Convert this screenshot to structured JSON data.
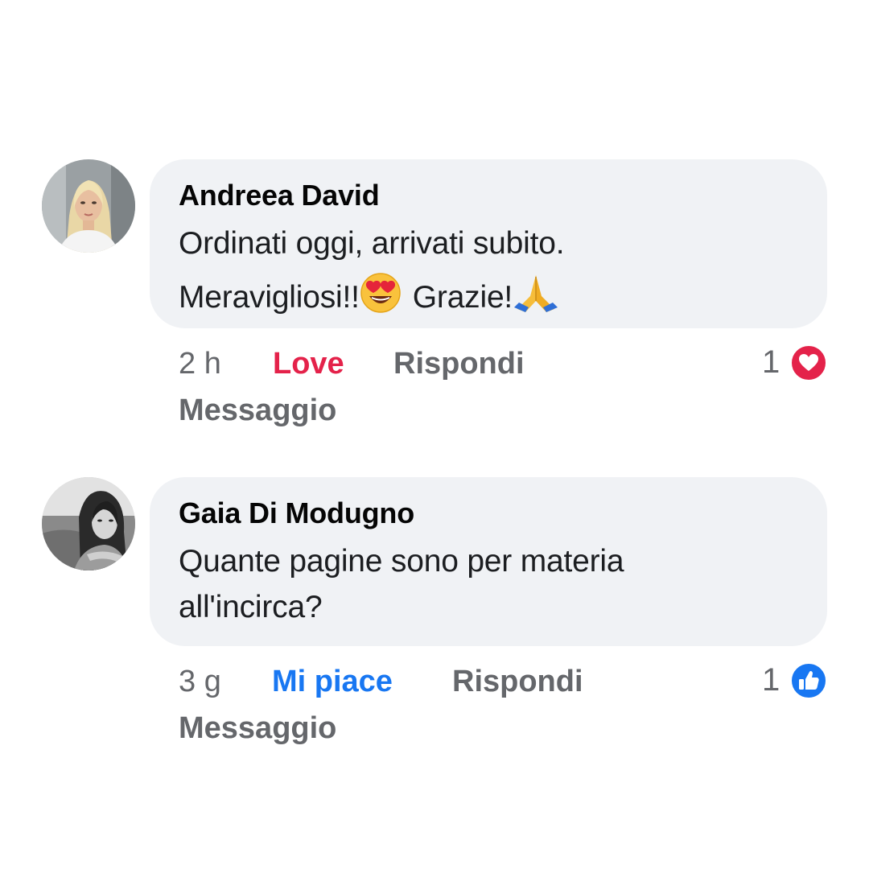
{
  "comments": [
    {
      "author": "Andreea David",
      "lines": [
        "Ordinati oggi, arrivati subito.",
        "Meravigliosi!!",
        "Grazie!"
      ],
      "emojis": [
        "heart-eyes",
        "folded-hands"
      ],
      "time": "2 h",
      "reaction_action": "Love",
      "reply_label": "Rispondi",
      "message_label": "Messaggio",
      "reaction_count": "1",
      "reaction_type": "love",
      "reaction_color": "#e4224a"
    },
    {
      "author": "Gaia Di Modugno",
      "lines": [
        "Quante pagine sono per materia",
        "all'incirca?"
      ],
      "time": "3 g",
      "reaction_action": "Mi piace",
      "reply_label": "Rispondi",
      "message_label": "Messaggio",
      "reaction_count": "1",
      "reaction_type": "like",
      "reaction_color": "#1877f2"
    }
  ]
}
